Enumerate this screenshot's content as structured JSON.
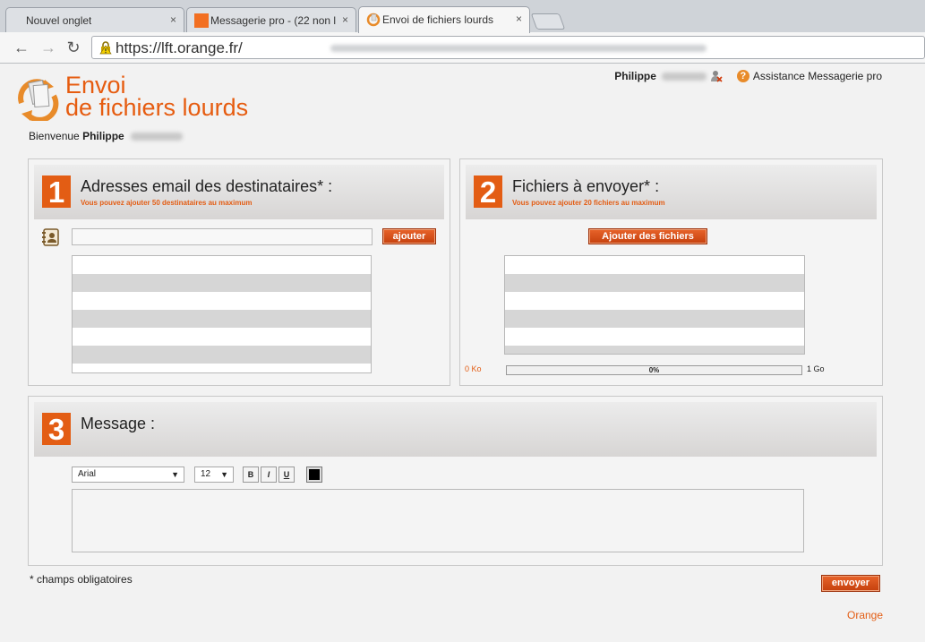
{
  "browser": {
    "tabs": [
      {
        "title": "Nouvel onglet",
        "close": "×"
      },
      {
        "title": "Messagerie pro - (22 non l",
        "close": "×"
      },
      {
        "title": "Envoi de fichiers lourds",
        "close": "×"
      }
    ],
    "url": "https://lft.orange.fr/",
    "nav": {
      "back": "←",
      "forward": "→",
      "reload": "↻"
    }
  },
  "page": {
    "logo": {
      "line1": "Envoi",
      "line2": "de fichiers lourds"
    },
    "user": {
      "first_name": "Philippe",
      "help_link": "Assistance Messagerie pro"
    },
    "welcome": {
      "prefix": "Bienvenue",
      "name": "Philippe"
    },
    "step1": {
      "number": "1",
      "title": "Adresses email des destinataires* :",
      "subtitle": "Vous pouvez ajouter 50 destinataires au maximum",
      "add_button": "ajouter",
      "email_value": ""
    },
    "step2": {
      "number": "2",
      "title": "Fichiers à envoyer* :",
      "subtitle": "Vous pouvez ajouter 20 fichiers au maximum",
      "add_button": "Ajouter des fichiers",
      "progress_min": "0 Ko",
      "progress_max": "1 Go",
      "progress_label": "0%",
      "progress_fraction": 0
    },
    "step3": {
      "number": "3",
      "title": "Message :",
      "font": "Arial",
      "font_size": "12",
      "bold": "B",
      "italic": "I",
      "underline": "U",
      "text_color": "#000000"
    },
    "required_note": "* champs obligatoires",
    "send_button": "envoyer",
    "footer_link": "Orange"
  },
  "colors": {
    "accent": "#e35d14"
  }
}
